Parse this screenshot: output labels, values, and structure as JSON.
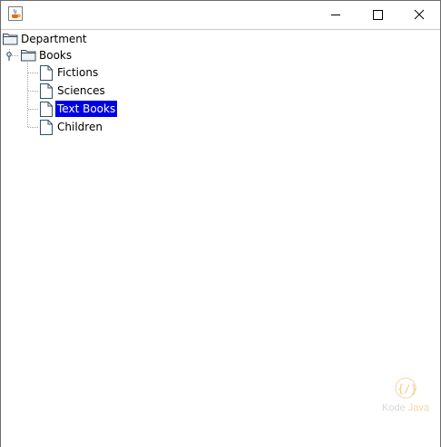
{
  "window": {
    "app_icon": "java-cup-icon",
    "controls": {
      "minimize": "minimize-icon",
      "maximize": "maximize-icon",
      "close": "close-icon"
    }
  },
  "tree": {
    "root": {
      "label": "Department",
      "icon": "folder-open-icon",
      "children": [
        {
          "label": "Books",
          "icon": "folder-open-icon",
          "expanded": true,
          "children": [
            {
              "label": "Fictions",
              "icon": "file-icon",
              "selected": false
            },
            {
              "label": "Sciences",
              "icon": "file-icon",
              "selected": false
            },
            {
              "label": "Text Books",
              "icon": "file-icon",
              "selected": true
            },
            {
              "label": "Children",
              "icon": "file-icon",
              "selected": false
            }
          ]
        }
      ]
    },
    "selection_color": "#0000e6"
  },
  "watermark": {
    "logo": "kode-java-logo-icon",
    "word1": "Kode",
    "word2": "Java"
  }
}
